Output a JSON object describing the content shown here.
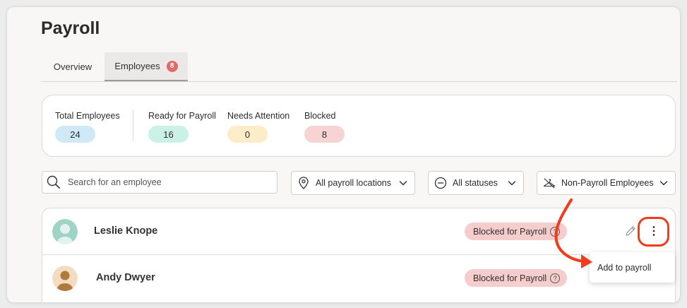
{
  "page": {
    "title": "Payroll"
  },
  "tabs": [
    {
      "label": "Overview"
    },
    {
      "label": "Employees",
      "badge": "8"
    }
  ],
  "summary": [
    {
      "label": "Total Employees",
      "value": "24",
      "color": "#cfe9f6"
    },
    {
      "label": "Ready for Payroll",
      "value": "16",
      "color": "#c9f1e6"
    },
    {
      "label": "Needs Attention",
      "value": "0",
      "color": "#fdecc8"
    },
    {
      "label": "Blocked",
      "value": "8",
      "color": "#f8d3d3"
    }
  ],
  "filters": {
    "search_placeholder": "Search for an employee",
    "location": "All payroll locations",
    "status": "All statuses",
    "type": "Non-Payroll Employees"
  },
  "employees": [
    {
      "name": "Leslie Knope",
      "status": "Blocked for Payroll",
      "avatar": "avatar-green"
    },
    {
      "name": "Andy Dwyer",
      "status": "Blocked for Payroll",
      "avatar": "avatar-tan"
    }
  ],
  "status_help_glyph": "?",
  "context_menu": {
    "item": "Add to payroll"
  },
  "colors": {
    "accent_red": "#f23b1b",
    "badge_red": "#e06a6a",
    "blocked_pill": "#f5cdcd"
  }
}
